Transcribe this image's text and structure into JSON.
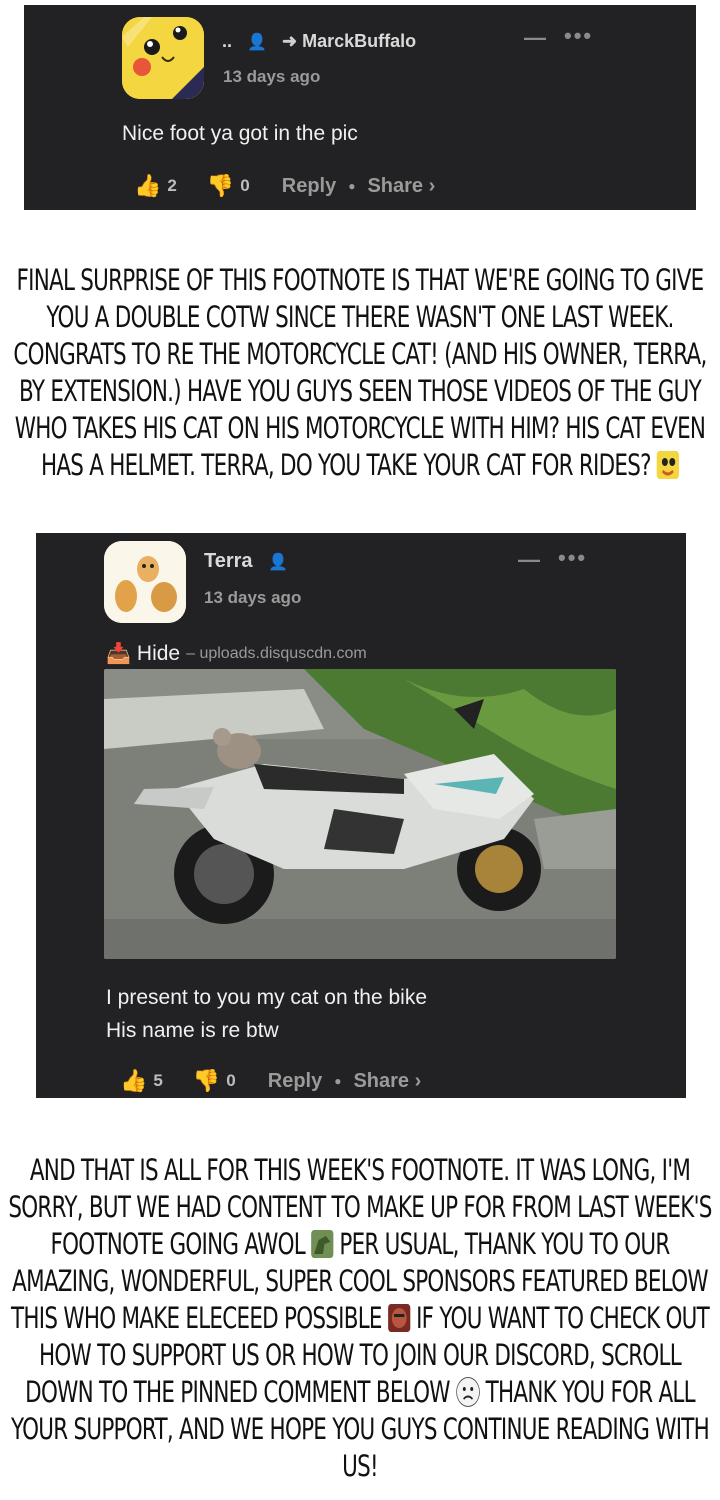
{
  "comment1": {
    "reply_marker": "..",
    "reply_to": "MarckBuffalo",
    "time": "13 days ago",
    "text": "Nice foot ya got in the pic",
    "upvotes": "2",
    "downvotes": "0",
    "reply_label": "Reply",
    "share_label": "Share ›"
  },
  "caption1": "FINAL SURPRISE OF THIS FOOTNOTE IS THAT WE'RE GOING TO GIVE YOU A DOUBLE COTW SINCE THERE WASN'T ONE LAST WEEK. CONGRATS TO RE THE MOTORCYCLE CAT! (AND HIS OWNER, TERRA, BY EXTENSION.) HAVE YOU GUYS SEEN THOSE VIDEOS OF THE GUY WHO TAKES HIS CAT ON HIS MOTORCYCLE WITH HIM? HIS CAT EVEN HAS A HELMET. TERRA, DO YOU TAKE YOUR CAT FOR RIDES?",
  "comment2": {
    "author": "Terra",
    "time": "13 days ago",
    "hide_label": "Hide",
    "source": "– uploads.disquscdn.com",
    "line1": "I present to you my cat on the bike",
    "line2": "His name is re btw",
    "upvotes": "5",
    "downvotes": "0",
    "reply_label": "Reply",
    "share_label": "Share ›"
  },
  "caption2": {
    "part1": "AND THAT IS ALL FOR THIS WEEK'S FOOTNOTE. IT WAS LONG, I'M SORRY, BUT WE HAD CONTENT TO MAKE UP FOR FROM LAST WEEK'S FOOTNOTE GOING AWOL",
    "part2": "PER USUAL, THANK YOU TO OUR AMAZING, WONDERFUL, SUPER COOL SPONSORS FEATURED BELOW THIS WHO MAKE ELECEED POSSIBLE",
    "part3": "IF YOU WANT TO CHECK OUT HOW TO SUPPORT US OR HOW TO JOIN OUR DISCORD, SCROLL DOWN TO THE PINNED COMMENT BELOW",
    "part4": "THANK YOU FOR ALL YOUR SUPPORT, AND WE HOPE YOU GUYS CONTINUE READING WITH US!"
  }
}
